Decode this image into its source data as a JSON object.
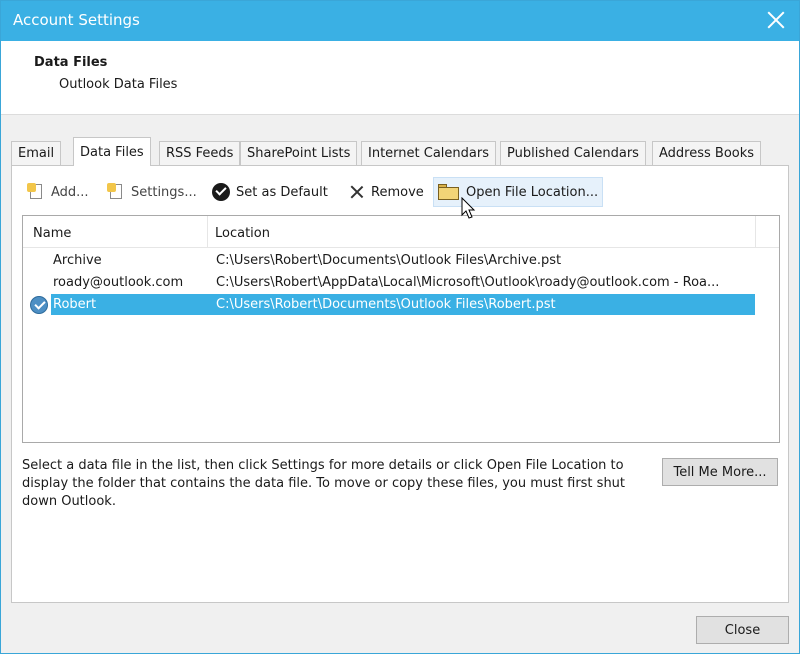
{
  "window": {
    "title": "Account Settings"
  },
  "header": {
    "title": "Data Files",
    "subtitle": "Outlook Data Files"
  },
  "tabs": [
    {
      "label": "Email",
      "active": false
    },
    {
      "label": "Data Files",
      "active": true
    },
    {
      "label": "RSS Feeds",
      "active": false
    },
    {
      "label": "SharePoint Lists",
      "active": false
    },
    {
      "label": "Internet Calendars",
      "active": false
    },
    {
      "label": "Published Calendars",
      "active": false
    },
    {
      "label": "Address Books",
      "active": false
    }
  ],
  "toolbar": {
    "add_label": "Add...",
    "settings_label": "Settings...",
    "set_default_label": "Set as Default",
    "remove_label": "Remove",
    "open_location_label": "Open File Location..."
  },
  "list": {
    "columns": {
      "name": "Name",
      "location": "Location"
    },
    "rows": [
      {
        "name": "Archive",
        "location": "C:\\Users\\Robert\\Documents\\Outlook Files\\Archive.pst",
        "selected": false,
        "default": false
      },
      {
        "name": "roady@outlook.com",
        "location": "C:\\Users\\Robert\\AppData\\Local\\Microsoft\\Outlook\\roady@outlook.com - Roa...",
        "selected": false,
        "default": false
      },
      {
        "name": "Robert",
        "location": "C:\\Users\\Robert\\Documents\\Outlook Files\\Robert.pst",
        "selected": true,
        "default": true
      }
    ]
  },
  "help_text": "Select a data file in the list, then click Settings for more details or click Open File Location to display the folder that contains the data file. To move or copy these files, you must first shut down Outlook.",
  "buttons": {
    "tell_me_more": "Tell Me More...",
    "close": "Close"
  },
  "colors": {
    "titlebar": "#3ab0e4",
    "selection": "#3ab0e4"
  }
}
